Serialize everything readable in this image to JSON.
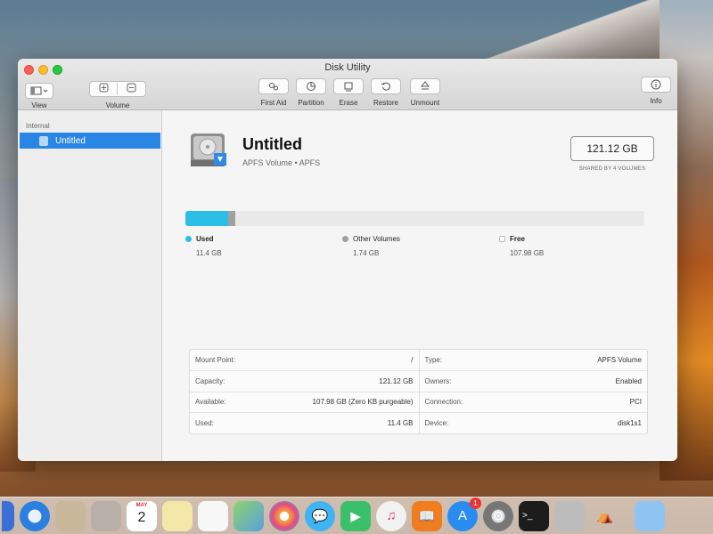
{
  "window": {
    "title": "Disk Utility"
  },
  "toolbar": {
    "view_label": "View",
    "volume_label": "Volume",
    "first_aid_label": "First Aid",
    "partition_label": "Partition",
    "erase_label": "Erase",
    "restore_label": "Restore",
    "unmount_label": "Unmount",
    "info_label": "Info"
  },
  "sidebar": {
    "section": "Internal",
    "items": [
      {
        "label": "Untitled",
        "selected": true
      }
    ]
  },
  "volume": {
    "name": "Untitled",
    "subtitle": "APFS Volume • APFS",
    "capacity": "121.12 GB",
    "capacity_caption": "SHARED BY 4 VOLUMES"
  },
  "usage": {
    "used": {
      "label": "Used",
      "value": "11.4 GB",
      "color": "#2cbfe6",
      "fraction": 0.094
    },
    "other": {
      "label": "Other Volumes",
      "value": "1.74 GB",
      "color": "#a0a0a0",
      "fraction": 0.014
    },
    "free": {
      "label": "Free",
      "value": "107.98 GB",
      "color": "#ffffff"
    }
  },
  "info": {
    "left": [
      {
        "key": "Mount Point:",
        "value": "/"
      },
      {
        "key": "Capacity:",
        "value": "121.12 GB"
      },
      {
        "key": "Available:",
        "value": "107.98 GB (Zero KB purgeable)"
      },
      {
        "key": "Used:",
        "value": "11.4 GB"
      }
    ],
    "right": [
      {
        "key": "Type:",
        "value": "APFS Volume"
      },
      {
        "key": "Owners:",
        "value": "Enabled"
      },
      {
        "key": "Connection:",
        "value": "PCI"
      },
      {
        "key": "Device:",
        "value": "disk1s1"
      }
    ]
  },
  "dock": {
    "calendar_month": "MAY",
    "calendar_day": "2",
    "app_store_badge": "1"
  }
}
